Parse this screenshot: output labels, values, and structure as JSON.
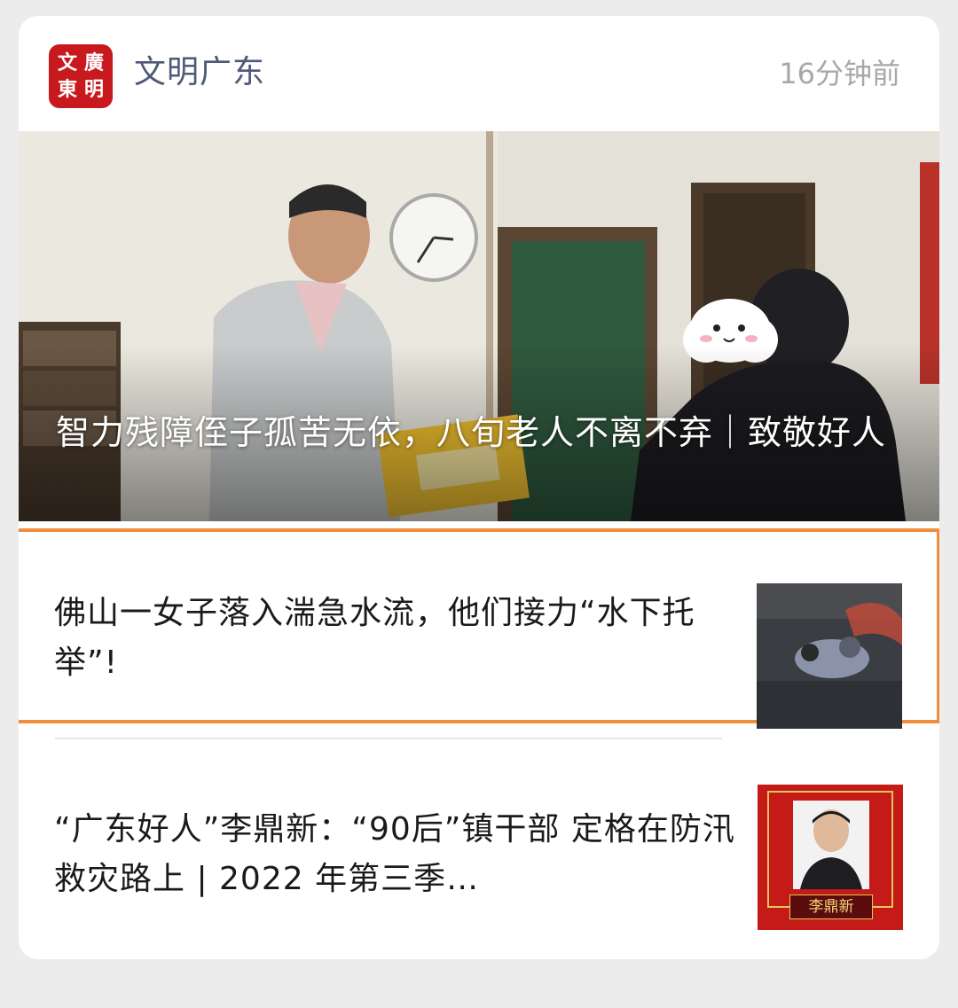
{
  "header": {
    "logo_chars": [
      "廣",
      "文",
      "東",
      "明"
    ],
    "source_name": "文明广东",
    "time": "16分钟前"
  },
  "hero": {
    "title": "智力残障侄子孤苦无依，八旬老人不离不弃｜致敬好人",
    "image_icon": "photo-elderly-man-giving-gift"
  },
  "articles": [
    {
      "title": "佛山一女子落入湍急水流，他们接力“水下托举”!",
      "thumb_icon": "photo-night-water-rescue",
      "highlighted": true
    },
    {
      "title": "“广东好人”李鼎新：“90后”镇干部 定格在防汛救灾路上 | 2022 年第三季…",
      "thumb_icon": "photo-portrait-red-frame",
      "thumb_caption": "李鼎新"
    }
  ],
  "colors": {
    "source_name": "#4e5a78",
    "highlight_border": "#f28d3c",
    "logo_red": "#c8191e"
  }
}
